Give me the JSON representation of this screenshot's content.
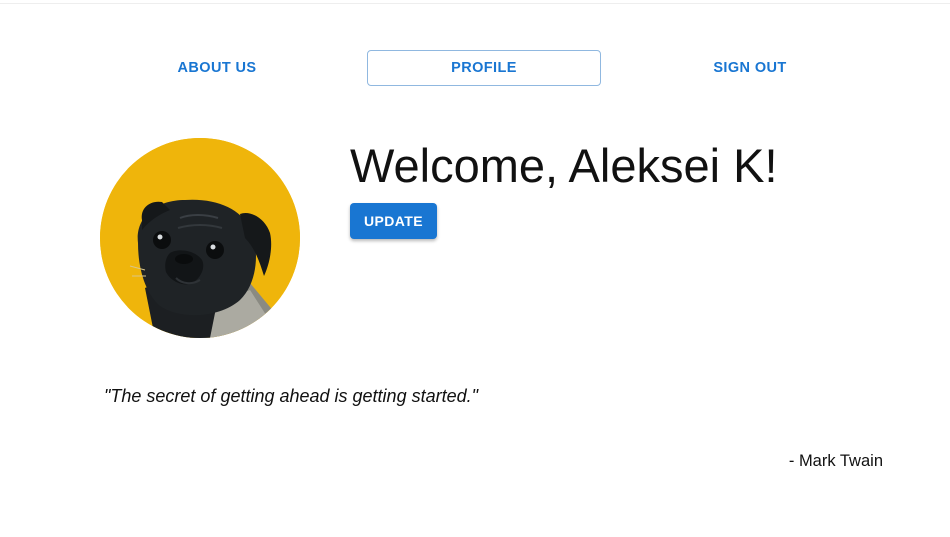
{
  "nav": {
    "items": [
      {
        "label": "ABOUT US"
      },
      {
        "label": "PROFILE"
      },
      {
        "label": "SIGN OUT"
      }
    ],
    "accent_color": "#1976d2"
  },
  "profile": {
    "welcome": "Welcome, Aleksei K!",
    "update_label": "UPDATE",
    "avatar_background": "#efb50b",
    "avatar_icon": "pug-dog-photo"
  },
  "quote": {
    "text": "\"The secret of getting ahead is getting started.\"",
    "author": "- Mark Twain"
  }
}
